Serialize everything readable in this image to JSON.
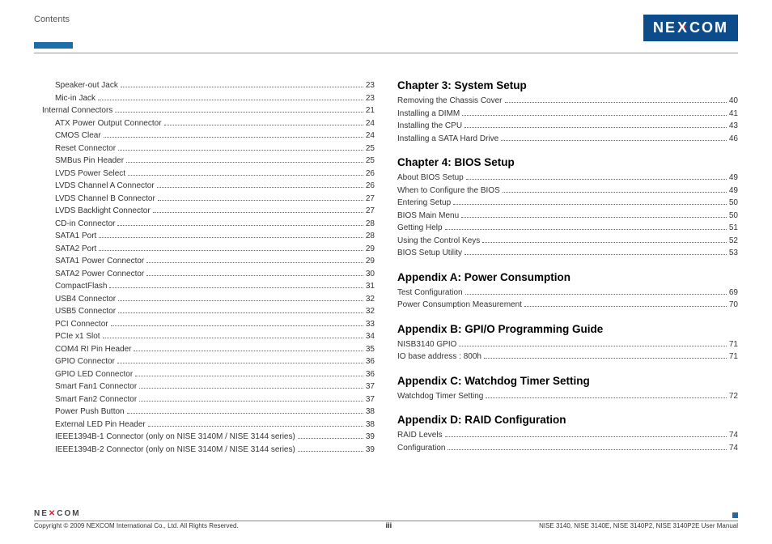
{
  "header": {
    "contents_label": "Contents",
    "logo_text_1": "NE",
    "logo_text_x": "X",
    "logo_text_2": "COM"
  },
  "col_left": [
    {
      "indent": 1,
      "label": "Speaker-out Jack",
      "page": "23"
    },
    {
      "indent": 1,
      "label": "Mic-in Jack",
      "page": "23"
    },
    {
      "indent": 0,
      "label": "Internal Connectors",
      "page": "21"
    },
    {
      "indent": 1,
      "label": "ATX Power Output Connector",
      "page": "24"
    },
    {
      "indent": 1,
      "label": "CMOS Clear",
      "page": "24"
    },
    {
      "indent": 1,
      "label": "Reset Connector",
      "page": "25"
    },
    {
      "indent": 1,
      "label": "SMBus Pin Header",
      "page": "25"
    },
    {
      "indent": 1,
      "label": "LVDS Power Select",
      "page": "26"
    },
    {
      "indent": 1,
      "label": "LVDS Channel A Connector",
      "page": "26"
    },
    {
      "indent": 1,
      "label": "LVDS Channel B Connector",
      "page": "27"
    },
    {
      "indent": 1,
      "label": "LVDS Backlight Connector",
      "page": "27"
    },
    {
      "indent": 1,
      "label": "CD-in Connector",
      "page": "28"
    },
    {
      "indent": 1,
      "label": "SATA1 Port",
      "page": "28"
    },
    {
      "indent": 1,
      "label": "SATA2 Port",
      "page": "29"
    },
    {
      "indent": 1,
      "label": "SATA1 Power Connector",
      "page": "29"
    },
    {
      "indent": 1,
      "label": "SATA2 Power Connector",
      "page": "30"
    },
    {
      "indent": 1,
      "label": "CompactFlash",
      "page": "31"
    },
    {
      "indent": 1,
      "label": "USB4 Connector",
      "page": "32"
    },
    {
      "indent": 1,
      "label": "USB5 Connector",
      "page": "32"
    },
    {
      "indent": 1,
      "label": "PCI Connector",
      "page": "33"
    },
    {
      "indent": 1,
      "label": "PCIe x1 Slot",
      "page": "34"
    },
    {
      "indent": 1,
      "label": "COM4 RI Pin Header",
      "page": "35"
    },
    {
      "indent": 1,
      "label": "GPIO Connector",
      "page": "36"
    },
    {
      "indent": 1,
      "label": "GPIO LED Connector",
      "page": "36"
    },
    {
      "indent": 1,
      "label": "Smart Fan1 Connector",
      "page": "37"
    },
    {
      "indent": 1,
      "label": "Smart Fan2 Connector",
      "page": "37"
    },
    {
      "indent": 1,
      "label": "Power Push Button",
      "page": "38"
    },
    {
      "indent": 1,
      "label": "External LED Pin Header",
      "page": "38"
    },
    {
      "indent": 1,
      "label": "IEEE1394B-1 Connector (only on NISE 3140M / NISE 3144 series)",
      "page": "39"
    },
    {
      "indent": 1,
      "label": "IEEE1394B-2 Connector (only on NISE 3140M / NISE 3144 series)",
      "page": "39"
    }
  ],
  "col_right": [
    {
      "type": "title",
      "first": true,
      "text": "Chapter 3: System Setup"
    },
    {
      "type": "row",
      "label": "Removing the Chassis Cover",
      "page": "40"
    },
    {
      "type": "row",
      "label": "Installing a DIMM",
      "page": "41"
    },
    {
      "type": "row",
      "label": "Installing the CPU",
      "page": "43"
    },
    {
      "type": "row",
      "label": "Installing a SATA Hard Drive",
      "page": "46"
    },
    {
      "type": "title",
      "text": "Chapter 4: BIOS Setup"
    },
    {
      "type": "row",
      "label": "About BIOS Setup",
      "page": "49"
    },
    {
      "type": "row",
      "label": "When to Configure the BIOS",
      "page": "49"
    },
    {
      "type": "row",
      "label": "Entering Setup",
      "page": "50"
    },
    {
      "type": "row",
      "label": "BIOS Main Menu",
      "page": "50"
    },
    {
      "type": "row",
      "label": "Getting Help",
      "page": "51"
    },
    {
      "type": "row",
      "label": "Using the Control Keys",
      "page": "52"
    },
    {
      "type": "row",
      "label": "BIOS Setup Utility",
      "page": "53"
    },
    {
      "type": "title",
      "text": "Appendix A: Power Consumption"
    },
    {
      "type": "row",
      "label": "Test Configuration",
      "page": "69"
    },
    {
      "type": "row",
      "label": "Power Consumption Measurement",
      "page": "70"
    },
    {
      "type": "title",
      "text": "Appendix B: GPI/O Programming Guide"
    },
    {
      "type": "row",
      "label": "NISB3140 GPIO",
      "page": "71"
    },
    {
      "type": "row",
      "label": "IO base address : 800h",
      "page": "71"
    },
    {
      "type": "title",
      "text": "Appendix C: Watchdog Timer Setting"
    },
    {
      "type": "row",
      "label": "Watchdog Timer Setting",
      "page": "72"
    },
    {
      "type": "title",
      "text": "Appendix D: RAID Configuration"
    },
    {
      "type": "row",
      "label": "RAID Levels",
      "page": "74"
    },
    {
      "type": "row",
      "label": "Configuration",
      "page": "74"
    }
  ],
  "footer": {
    "logo": "NE COM",
    "copyright": "Copyright © 2009 NEXCOM International Co., Ltd. All Rights Reserved.",
    "page_num": "iii",
    "manual_ref": "NISE 3140, NISE 3140E, NISE 3140P2, NISE 3140P2E User Manual"
  }
}
